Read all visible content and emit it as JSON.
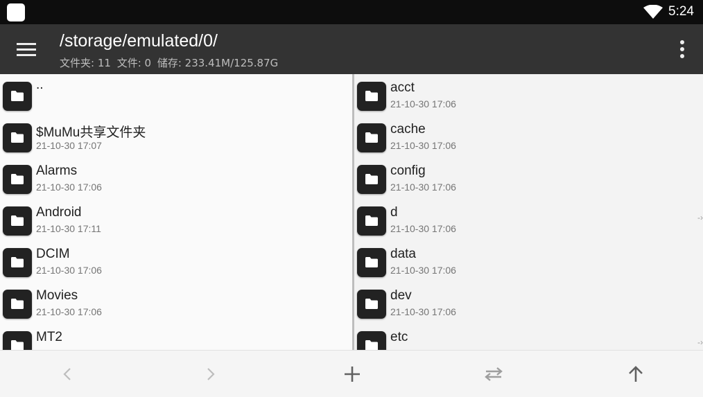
{
  "status_bar": {
    "time": "5:24",
    "icons": [
      "app-square-icon",
      "wifi-icon"
    ]
  },
  "app_bar": {
    "path": "/storage/emulated/0/",
    "info": {
      "folders": "文件夹: 11",
      "files": "文件: 0",
      "storage": "储存: 233.41M/125.87G"
    },
    "icons": [
      "menu-icon",
      "more-vert-icon"
    ]
  },
  "left_pane": {
    "items": [
      {
        "name": "..",
        "date": ""
      },
      {
        "name": "$MuMu共享文件夹",
        "date": "21-10-30 17:07"
      },
      {
        "name": "Alarms",
        "date": "21-10-30 17:06"
      },
      {
        "name": "Android",
        "date": "21-10-30 17:11"
      },
      {
        "name": "DCIM",
        "date": "21-10-30 17:06"
      },
      {
        "name": "Movies",
        "date": "21-10-30 17:06"
      },
      {
        "name": "MT2",
        "date": ""
      }
    ]
  },
  "right_pane": {
    "items": [
      {
        "name": "acct",
        "date": "21-10-30 17:06",
        "edge": ""
      },
      {
        "name": "cache",
        "date": "21-10-30 17:06",
        "edge": ""
      },
      {
        "name": "config",
        "date": "21-10-30 17:06",
        "edge": ""
      },
      {
        "name": "d",
        "date": "21-10-30 17:06",
        "edge": "-›"
      },
      {
        "name": "data",
        "date": "21-10-30 17:06",
        "edge": ""
      },
      {
        "name": "dev",
        "date": "21-10-30 17:06",
        "edge": ""
      },
      {
        "name": "etc",
        "date": "",
        "edge": "-›"
      }
    ]
  },
  "bottom_bar": {
    "buttons": [
      "back-icon",
      "forward-icon",
      "add-icon",
      "swap-icon",
      "up-icon"
    ],
    "disabled_color": "#bdbdbd",
    "active_color": "#616161"
  },
  "colors": {
    "status_bar": "#0d0d0d",
    "app_bar": "#333333",
    "folder_icon": "#222222"
  }
}
